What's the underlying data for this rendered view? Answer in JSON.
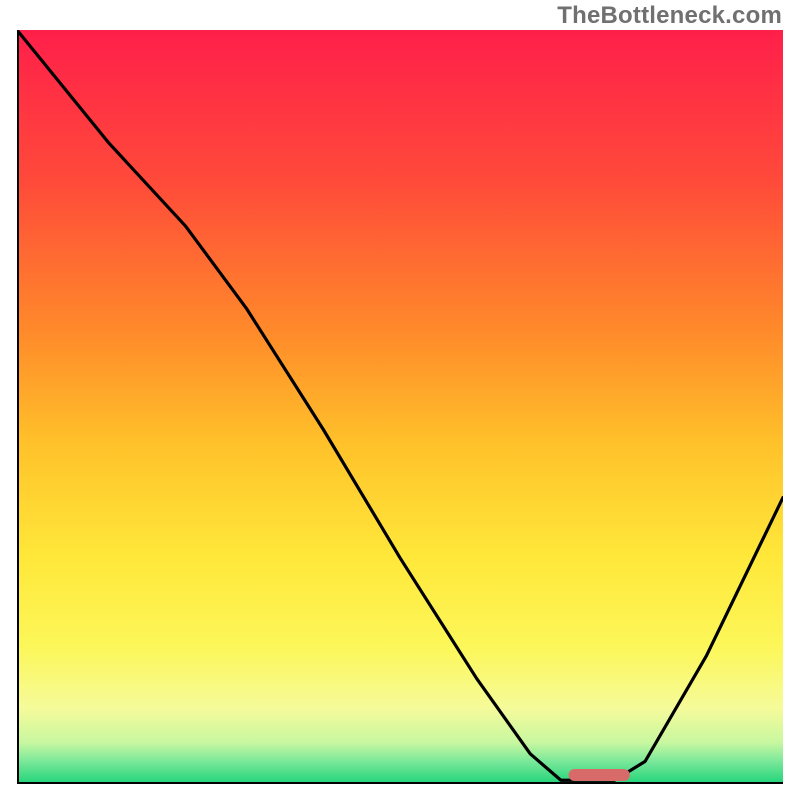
{
  "watermark": "TheBottleneck.com",
  "chart_data": {
    "type": "line",
    "title": "",
    "xlabel": "",
    "ylabel": "",
    "xlim": [
      0,
      100
    ],
    "ylim": [
      0,
      100
    ],
    "gradient_stops": [
      {
        "offset": 0.0,
        "color": "#ff1f4a"
      },
      {
        "offset": 0.2,
        "color": "#ff4a3a"
      },
      {
        "offset": 0.4,
        "color": "#ff8a2a"
      },
      {
        "offset": 0.55,
        "color": "#ffc22a"
      },
      {
        "offset": 0.7,
        "color": "#ffe83a"
      },
      {
        "offset": 0.82,
        "color": "#fcf75a"
      },
      {
        "offset": 0.9,
        "color": "#f5fb9a"
      },
      {
        "offset": 0.945,
        "color": "#c8f7a0"
      },
      {
        "offset": 0.97,
        "color": "#7ae89a"
      },
      {
        "offset": 1.0,
        "color": "#20d47a"
      }
    ],
    "series": [
      {
        "name": "curve",
        "points": [
          {
            "x": 0.0,
            "y": 100.0
          },
          {
            "x": 12.0,
            "y": 85.0
          },
          {
            "x": 22.0,
            "y": 74.0
          },
          {
            "x": 30.0,
            "y": 63.0
          },
          {
            "x": 40.0,
            "y": 47.0
          },
          {
            "x": 50.0,
            "y": 30.0
          },
          {
            "x": 60.0,
            "y": 14.0
          },
          {
            "x": 67.0,
            "y": 4.0
          },
          {
            "x": 71.0,
            "y": 0.5
          },
          {
            "x": 78.0,
            "y": 0.5
          },
          {
            "x": 82.0,
            "y": 3.0
          },
          {
            "x": 90.0,
            "y": 17.0
          },
          {
            "x": 100.0,
            "y": 38.0
          }
        ]
      }
    ],
    "marker": {
      "x_start": 72.0,
      "x_end": 80.0,
      "y": 1.2,
      "color": "#d86a6a"
    },
    "axes": {
      "left": {
        "from": [
          0,
          0
        ],
        "to": [
          0,
          100
        ]
      },
      "bottom": {
        "from": [
          0,
          0
        ],
        "to": [
          100,
          0
        ]
      }
    }
  }
}
